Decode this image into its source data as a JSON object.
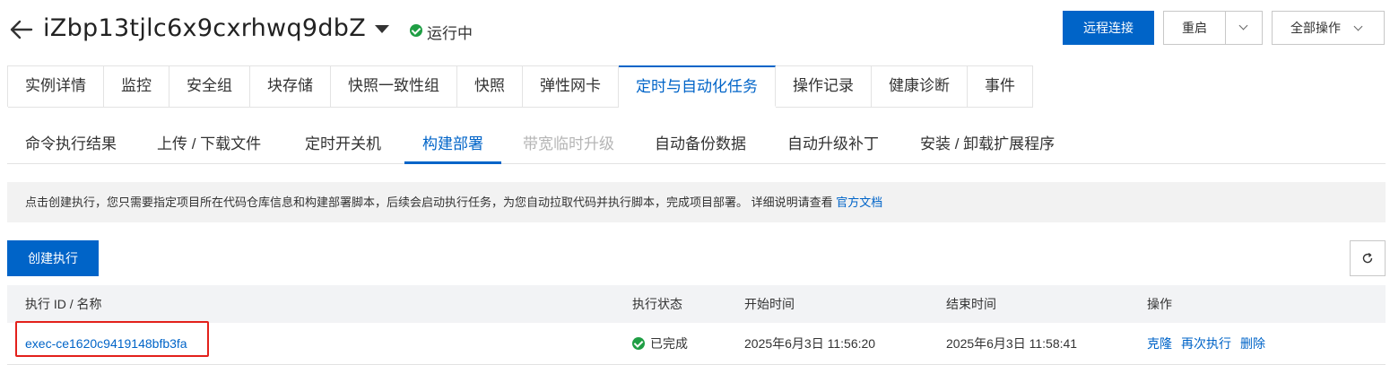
{
  "header": {
    "instance_id": "iZbp13tjlc6x9cxrhwq9dbZ",
    "status": "运行中",
    "remote_connect": "远程连接",
    "restart": "重启",
    "all_ops": "全部操作"
  },
  "main_tabs": [
    {
      "label": "实例详情"
    },
    {
      "label": "监控"
    },
    {
      "label": "安全组"
    },
    {
      "label": "块存储"
    },
    {
      "label": "快照一致性组"
    },
    {
      "label": "快照"
    },
    {
      "label": "弹性网卡"
    },
    {
      "label": "定时与自动化任务",
      "active": true
    },
    {
      "label": "操作记录"
    },
    {
      "label": "健康诊断"
    },
    {
      "label": "事件"
    }
  ],
  "sub_tabs": [
    {
      "label": "命令执行结果"
    },
    {
      "label": "上传 / 下载文件"
    },
    {
      "label": "定时开关机"
    },
    {
      "label": "构建部署",
      "active": true
    },
    {
      "label": "带宽临时升级",
      "disabled": true
    },
    {
      "label": "自动备份数据"
    },
    {
      "label": "自动升级补丁"
    },
    {
      "label": "安装 / 卸载扩展程序"
    }
  ],
  "notice": {
    "text": "点击创建执行，您只需要指定项目所在代码仓库信息和构建部署脚本，后续会启动执行任务，为您自动拉取代码并执行脚本，完成项目部署。  详细说明请查看 ",
    "link": "官方文档"
  },
  "create_button": "创建执行",
  "table": {
    "headers": {
      "id_name": "执行 ID / 名称",
      "status": "执行状态",
      "start": "开始时间",
      "end": "结束时间",
      "ops": "操作"
    },
    "rows": [
      {
        "id": "exec-ce1620c9419148bfb3fa",
        "status": "已完成",
        "start": "2025年6月3日 11:56:20",
        "end": "2025年6月3日 11:58:41",
        "ops": [
          "克隆",
          "再次执行",
          "删除"
        ]
      }
    ]
  },
  "colors": {
    "primary": "#0064c8",
    "success": "#1f9e44",
    "highlight": "#e3201b"
  },
  "icons": [
    "back-arrow-icon",
    "caret-down-icon",
    "check-circle-icon",
    "chevron-down-icon",
    "refresh-icon"
  ]
}
